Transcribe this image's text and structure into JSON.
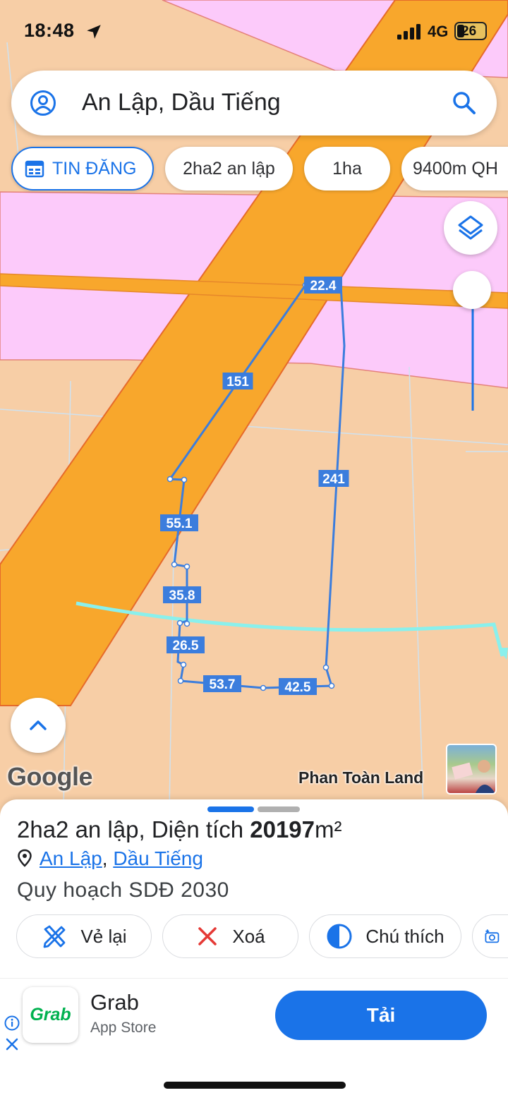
{
  "status_bar": {
    "time": "18:48",
    "network": "4G",
    "battery": "26"
  },
  "search": {
    "query": "An Lập, Dầu Tiếng"
  },
  "chips": [
    {
      "label": "TIN ĐĂNG",
      "icon": "calendar-icon"
    },
    {
      "label": "2ha2 an lập"
    },
    {
      "label": "1ha"
    },
    {
      "label": "9400m QH"
    }
  ],
  "map": {
    "segment_lengths": [
      "22.4",
      "151",
      "241",
      "55.1",
      "35.8",
      "26.5",
      "53.7",
      "42.5"
    ],
    "attribution": "Google",
    "author": "Phan Toàn Land",
    "colors": {
      "land": "#f7cea6",
      "road": "#f8a72c",
      "residential": "#fccafa",
      "boundary": "#3b7ddd",
      "river": "#8af0ec"
    }
  },
  "parcel": {
    "name": "2ha2 an lập",
    "area_label": "Diện tích",
    "area_value": "20197",
    "area_unit": "m²",
    "ward": "An Lập",
    "district": "Dầu Tiếng",
    "separator": ", ",
    "planning": "Quy hoạch SDĐ 2030"
  },
  "actions": [
    {
      "label": "Vẻ lại",
      "icon": "redraw-icon"
    },
    {
      "label": "Xoá",
      "icon": "close-icon"
    },
    {
      "label": "Chú thích",
      "icon": "legend-icon"
    }
  ],
  "ad": {
    "app_name": "Grab",
    "store": "App Store",
    "cta": "Tải",
    "logo_text": "Grab"
  }
}
